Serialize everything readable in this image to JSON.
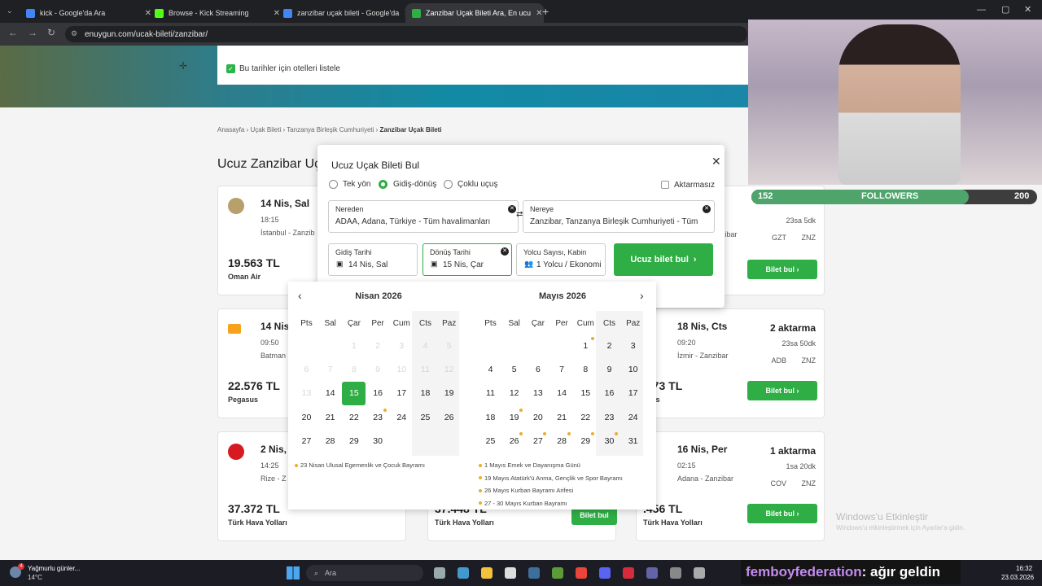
{
  "browser": {
    "tabs": [
      {
        "title": "kick - Google'da Ara",
        "color": "#4285f4"
      },
      {
        "title": "Browse - Kick Streaming",
        "color": "#53fc18"
      },
      {
        "title": "zanzibar uçak bileti - Google'da",
        "color": "#4285f4"
      },
      {
        "title": "Zanzibar Uçak Bileti Ara, En ucu",
        "color": "#2eae45"
      }
    ],
    "url": "enuygun.com/ucak-bileti/zanzibar/"
  },
  "page": {
    "hotel_checkbox_label": "Bu tarihler için otelleri listele",
    "breadcrumb": [
      "Anasayfa",
      "Uçak Bileti",
      "Tanzanya Birleşik Cumhuriyeti",
      "Zanzibar Uçak Bileti"
    ],
    "title": "Ucuz Zanzibar Uç",
    "buy_label": "Bilet bul",
    "cards": [
      {
        "date": "14 Nis, Sal",
        "time": "18:15",
        "route": "İstanbul - Zanzib",
        "price": "19.563 TL",
        "airline": "Oman Air"
      },
      {
        "date": "14 Nis",
        "time": "09:50",
        "route": "Batman",
        "price": "22.576 TL",
        "airline": "Pegasus"
      },
      {
        "date": "2 Nis,",
        "time": "14:25",
        "route": "Rize - Z",
        "price": "37.372 TL",
        "airline": "Türk Hava Yolları"
      },
      {
        "date": "18 Nis, Cts",
        "time": "09:20",
        "route": "İzmir - Zanzibar",
        "price": ".573 TL",
        "airline": "asus",
        "stops": "2 aktarma",
        "duration": "23sa 50dk",
        "codes": [
          "ADB",
          "ZNZ"
        ]
      },
      {
        "date": "16 Nis, Per",
        "time": "02:15",
        "route": "Adana - Zanzibar",
        "price": ".456 TL",
        "airline": "Türk Hava Yolları",
        "stops": "1 aktarma",
        "duration": "1sa 20dk",
        "codes": [
          "COV",
          "ZNZ"
        ]
      }
    ],
    "right_top": {
      "duration": "23sa 5dk",
      "codes": [
        "GZT",
        "ZNZ"
      ],
      "route_tail": "zibar"
    },
    "mid_bottom": {
      "price": "37.448 TL",
      "airline": "Türk Hava Yolları"
    }
  },
  "modal": {
    "title": "Ucuz Uçak Bileti Bul",
    "trip_types": [
      "Tek yön",
      "Gidiş-dönüş",
      "Çoklu uçuş"
    ],
    "selected_trip": 1,
    "nonstop_label": "Aktarmasız",
    "from": {
      "label": "Nereden",
      "value": "ADAA, Adana, Türkiye - Tüm havalimanları"
    },
    "to": {
      "label": "Nereye",
      "value": "Zanzibar, Tanzanya Birleşik Cumhuriyeti - Tüm"
    },
    "depart": {
      "label": "Gidiş Tarihi",
      "value": "14 Nis, Sal"
    },
    "return": {
      "label": "Dönüş Tarihi",
      "value": "15 Nis, Çar"
    },
    "pax": {
      "label": "Yolcu Sayısı, Kabin",
      "value": "1 Yolcu / Ekonomi"
    },
    "search_label": "Ucuz bilet bul"
  },
  "calendar": {
    "weekdays": [
      "Pts",
      "Sal",
      "Çar",
      "Per",
      "Cum",
      "Cts",
      "Paz"
    ],
    "months": [
      {
        "title": "Nisan 2026",
        "rows": [
          [
            {
              "d": ""
            },
            {
              "d": ""
            },
            {
              "d": "1",
              "m": 1
            },
            {
              "d": "2",
              "m": 1
            },
            {
              "d": "3",
              "m": 1
            },
            {
              "d": "4",
              "m": 1
            },
            {
              "d": "5",
              "m": 1
            }
          ],
          [
            {
              "d": "6",
              "m": 1
            },
            {
              "d": "7",
              "m": 1
            },
            {
              "d": "8",
              "m": 1
            },
            {
              "d": "9",
              "m": 1
            },
            {
              "d": "10",
              "m": 1
            },
            {
              "d": "11",
              "m": 1
            },
            {
              "d": "12",
              "m": 1
            }
          ],
          [
            {
              "d": "13",
              "m": 1
            },
            {
              "d": "14"
            },
            {
              "d": "15",
              "s": 1
            },
            {
              "d": "16"
            },
            {
              "d": "17"
            },
            {
              "d": "18"
            },
            {
              "d": "19"
            }
          ],
          [
            {
              "d": "20"
            },
            {
              "d": "21"
            },
            {
              "d": "22"
            },
            {
              "d": "23",
              "h": 1
            },
            {
              "d": "24"
            },
            {
              "d": "25"
            },
            {
              "d": "26"
            }
          ],
          [
            {
              "d": "27"
            },
            {
              "d": "28"
            },
            {
              "d": "29"
            },
            {
              "d": "30"
            },
            {
              "d": ""
            },
            {
              "d": ""
            },
            {
              "d": ""
            }
          ]
        ],
        "holidays": [
          "23 Nisan Ulusal Egemenlik ve Çocuk Bayramı"
        ]
      },
      {
        "title": "Mayıs 2026",
        "rows": [
          [
            {
              "d": ""
            },
            {
              "d": ""
            },
            {
              "d": ""
            },
            {
              "d": ""
            },
            {
              "d": "1",
              "h": 1
            },
            {
              "d": "2"
            },
            {
              "d": "3"
            }
          ],
          [
            {
              "d": "4"
            },
            {
              "d": "5"
            },
            {
              "d": "6"
            },
            {
              "d": "7"
            },
            {
              "d": "8"
            },
            {
              "d": "9"
            },
            {
              "d": "10"
            }
          ],
          [
            {
              "d": "11"
            },
            {
              "d": "12"
            },
            {
              "d": "13"
            },
            {
              "d": "14"
            },
            {
              "d": "15"
            },
            {
              "d": "16"
            },
            {
              "d": "17"
            }
          ],
          [
            {
              "d": "18"
            },
            {
              "d": "19",
              "h": 1
            },
            {
              "d": "20"
            },
            {
              "d": "21"
            },
            {
              "d": "22"
            },
            {
              "d": "23"
            },
            {
              "d": "24"
            }
          ],
          [
            {
              "d": "25"
            },
            {
              "d": "26",
              "h": 1
            },
            {
              "d": "27",
              "h": 1
            },
            {
              "d": "28",
              "h": 1
            },
            {
              "d": "29",
              "h": 1
            },
            {
              "d": "30",
              "h": 1
            },
            {
              "d": "31"
            }
          ]
        ],
        "holidays": [
          "1 Mayıs Emek ve Dayanışma Günü",
          "19 Mayıs Atatürk'ü Anma, Gençlik ve Spor Bayramı",
          "26 Mayıs Kurban Bayramı Arifesi",
          "27 - 30 Mayıs Kurban Bayramı"
        ]
      }
    ]
  },
  "stream": {
    "followers_label": "FOLLOWERS",
    "followers_current": "152",
    "followers_goal": "200",
    "progress": 0.76,
    "chat_user": "femboyfederation",
    "chat_text": ": ağır geldin"
  },
  "system": {
    "activation_title": "Windows'u Etkinleştir",
    "activation_sub": "Windows'u etkinleştirmek için Ayarlar'a gidin.",
    "weather_text": "Yağmurlu günler...",
    "temp": "14°C",
    "search_placeholder": "Ara",
    "time": "16:32",
    "date": "23.03.2026",
    "notif_count": "4"
  }
}
